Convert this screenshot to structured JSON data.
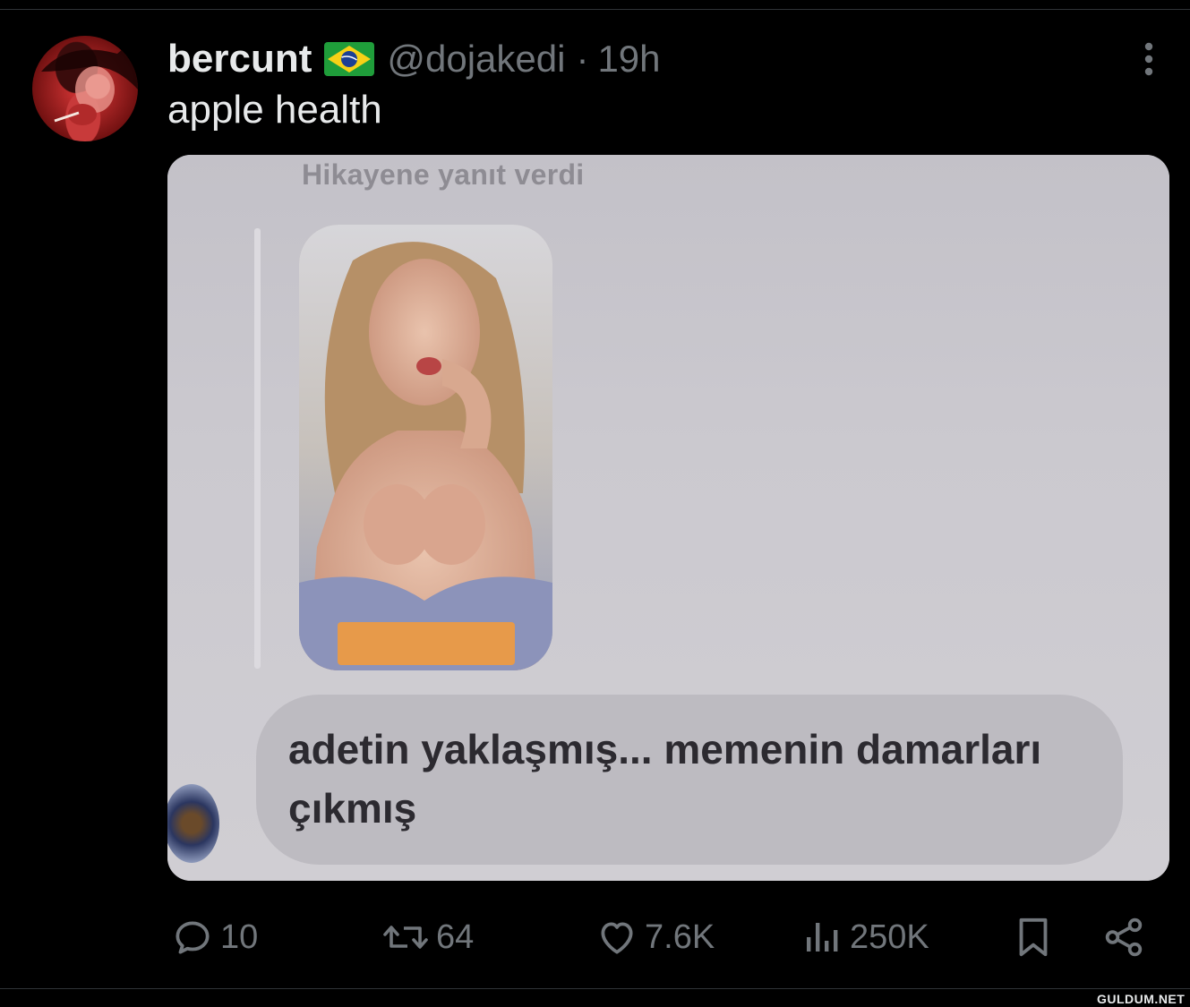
{
  "tweet": {
    "display_name": "bercunt",
    "handle": "@dojakedi",
    "separator": "·",
    "time": "19h",
    "text": "apple health",
    "flag_icon": "brazil-flag-icon"
  },
  "media": {
    "story_caption": "Hikayene yanıt verdi",
    "reply_text": "adetin yaklaşmış... memenin damarları çıkmış"
  },
  "actions": {
    "replies": "10",
    "reposts": "64",
    "likes": "7.6K",
    "views": "250K"
  },
  "watermark": "GULDUM.NET",
  "colors": {
    "background": "#000000",
    "text_primary": "#e7e9ea",
    "text_secondary": "#71767b",
    "bubble": "#bdbbc1"
  }
}
